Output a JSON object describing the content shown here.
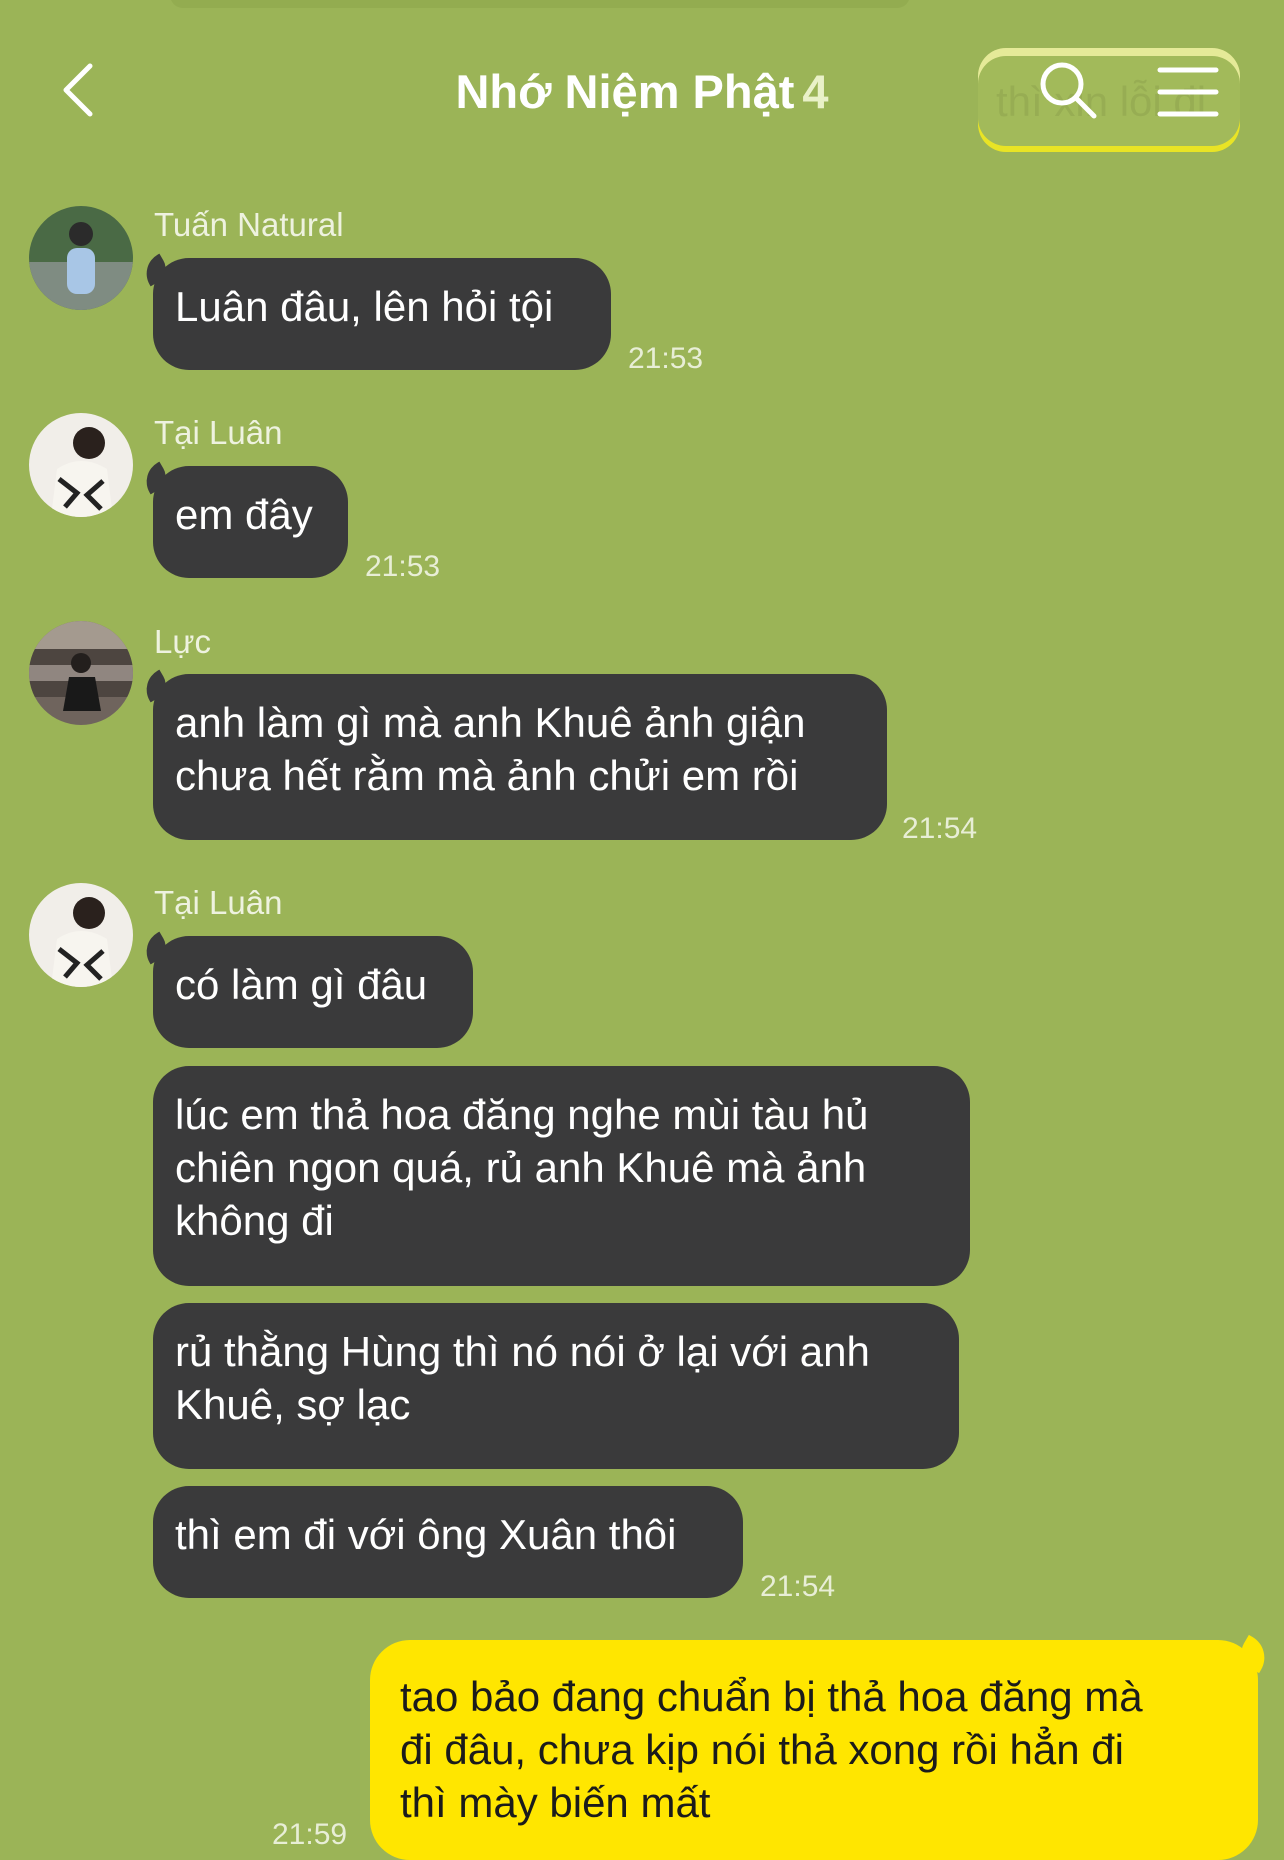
{
  "header": {
    "title": "Nhớ Niệm Phật",
    "member_count": "4",
    "preview_text": "thì xin lỗi đi",
    "back_icon": "chevron-left-icon",
    "search_icon": "search-icon",
    "menu_icon": "menu-icon"
  },
  "colors": {
    "background": "#9bb457",
    "incoming_bubble": "#3a3a3b",
    "outgoing_bubble": "#ffe600"
  },
  "messages": [
    {
      "sender": "Tuấn Natural",
      "bubbles": [
        "Luân đâu, lên hỏi tội"
      ],
      "time": "21:53"
    },
    {
      "sender": "Tại Luân",
      "bubbles": [
        "em đây"
      ],
      "time": "21:53"
    },
    {
      "sender": "Lực",
      "bubbles": [
        "anh làm gì mà anh Khuê ảnh giận\nchưa hết rằm mà ảnh chửi em rồi"
      ],
      "time": "21:54"
    },
    {
      "sender": "Tại Luân",
      "bubbles": [
        "có làm gì đâu",
        "lúc em thả hoa đăng nghe mùi tàu hủ\nchiên ngon quá, rủ anh Khuê mà ảnh\nkhông đi",
        "rủ thằng Hùng thì nó nói ở lại với anh\nKhuê, sợ lạc",
        "thì em đi với ông Xuân thôi"
      ],
      "time": "21:54"
    }
  ],
  "outgoing": {
    "text": "tao bảo đang chuẩn bị thả hoa đăng mà\nđi đâu, chưa kịp nói thả xong rồi hẳn đi\nthì mày biến mất",
    "time": "21:59"
  }
}
